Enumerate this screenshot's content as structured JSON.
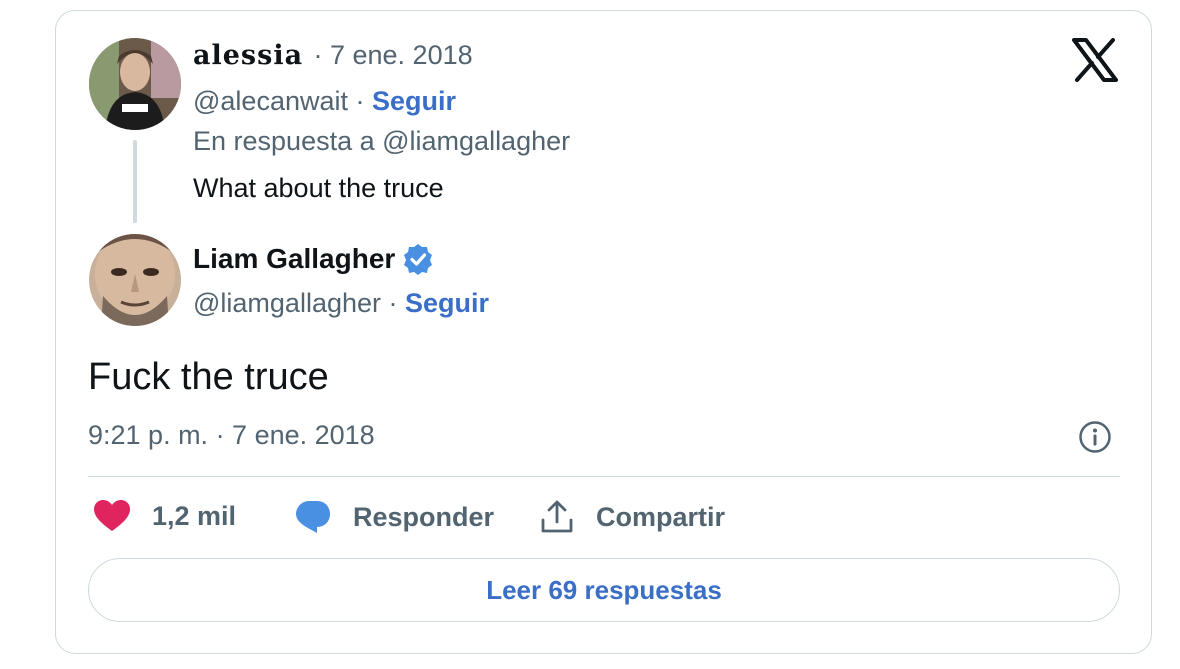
{
  "reply_tweet": {
    "author_name": "alessia",
    "date": "· 7 ene. 2018",
    "handle": "@alecanwait",
    "separator": " · ",
    "follow_label": "Seguir",
    "in_reply_to": "En respuesta a @liamgallagher",
    "text": "What about the truce"
  },
  "main_tweet": {
    "author_name": "Liam Gallagher",
    "verified": true,
    "handle": "@liamgallagher",
    "separator": " · ",
    "follow_label": "Seguir",
    "text": "Fuck the truce",
    "timestamp": "9:21 p. m. · 7 ene. 2018"
  },
  "actions": {
    "likes": "1,2 mil",
    "reply_label": "Responder",
    "share_label": "Compartir"
  },
  "read_replies_label": "Leer 69 respuestas",
  "colors": {
    "link": "#3b6fc7",
    "heart": "#e0245e",
    "reply_bubble": "#4a90e2",
    "verified": "#4a90e2"
  },
  "icons": [
    "x-logo-icon",
    "info-icon",
    "heart-icon",
    "reply-bubble-icon",
    "share-icon",
    "verified-badge-icon"
  ]
}
